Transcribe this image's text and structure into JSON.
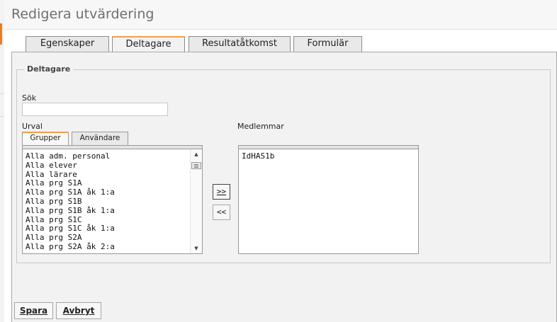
{
  "page": {
    "title": "Redigera utvärdering"
  },
  "tabs": [
    {
      "label": "Egenskaper"
    },
    {
      "label": "Deltagare"
    },
    {
      "label": "Resultatåtkomst"
    },
    {
      "label": "Formulär"
    }
  ],
  "participants": {
    "legend": "Deltagare",
    "search_label": "Sök",
    "search_value": "",
    "selection_label": "Urval",
    "subtabs": [
      {
        "label": "Grupper"
      },
      {
        "label": "Användare"
      }
    ],
    "groups": [
      "Alla adm. personal",
      "Alla elever",
      "Alla lärare",
      "Alla prg S1A",
      "Alla prg S1A åk 1:a",
      "Alla prg S1B",
      "Alla prg S1B åk 1:a",
      "Alla prg S1C",
      "Alla prg S1C åk 1:a",
      "Alla prg S2A",
      "Alla prg S2A åk 2:a"
    ],
    "add_label": ">>",
    "remove_label": "<<",
    "members_label": "Medlemmar",
    "members": [
      "IdHAS1b"
    ]
  },
  "footer": {
    "save_label": "Spara",
    "cancel_label": "Avbryt"
  },
  "colors": {
    "accent": "#f0a04b",
    "panel": "#f2f2f2",
    "left_marker": "#f07b1d"
  }
}
